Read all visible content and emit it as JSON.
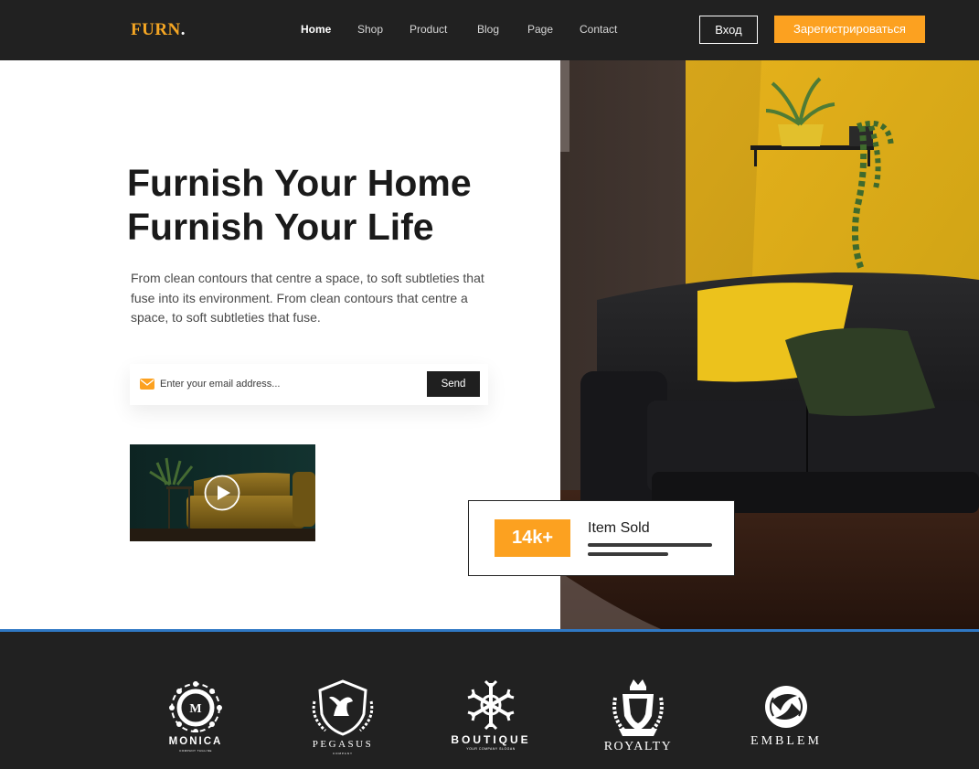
{
  "header": {
    "logo": "FURN",
    "logo_dot": ".",
    "nav": [
      {
        "label": "Home",
        "active": true
      },
      {
        "label": "Shop",
        "active": false
      },
      {
        "label": "Product",
        "active": false
      },
      {
        "label": "Blog",
        "active": false
      },
      {
        "label": "Page",
        "active": false
      },
      {
        "label": "Contact",
        "active": false
      }
    ],
    "login_label": "Вход",
    "register_label": "Зарегистрироваться"
  },
  "hero": {
    "title_line1": "Furnish Your Home",
    "title_line2": "Furnish Your Life",
    "description": "From clean contours that centre a space, to soft subtleties that fuse into its environment. From clean contours that centre a space, to soft subtleties that fuse.",
    "email_placeholder": "Enter your email address...",
    "send_label": "Send"
  },
  "stats": {
    "value": "14k+",
    "label": "Item Sold"
  },
  "brands": [
    {
      "name": "MONICA",
      "tagline": "COMPANY TAGLINE"
    },
    {
      "name": "PEGASUS",
      "tagline": "COMPANY"
    },
    {
      "name": "BOUTIQUE",
      "tagline": "YOUR COMPANY SLOGAN"
    },
    {
      "name": "ROYALTY",
      "tagline": ""
    },
    {
      "name": "EMBLEM",
      "tagline": ""
    }
  ],
  "colors": {
    "accent": "#fca120",
    "header_bg": "#212121",
    "divider": "#2f78c4"
  },
  "icons": [
    "mail-icon",
    "play-icon"
  ]
}
